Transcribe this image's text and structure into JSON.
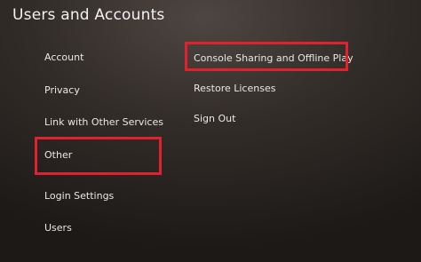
{
  "header": {
    "title": "Users and Accounts"
  },
  "sidebar": {
    "items": [
      {
        "label": "Account"
      },
      {
        "label": "Privacy"
      },
      {
        "label": "Link with Other Services"
      },
      {
        "label": "Other"
      },
      {
        "label": "Login Settings"
      },
      {
        "label": "Users"
      }
    ],
    "selected": "Other"
  },
  "options": {
    "items": [
      {
        "label": "Console Sharing and Offline Play"
      },
      {
        "label": "Restore Licenses"
      },
      {
        "label": "Sign Out"
      }
    ]
  },
  "colors": {
    "highlight": "#e3202e",
    "text": "#e8e8e8",
    "background": "#332d29"
  }
}
